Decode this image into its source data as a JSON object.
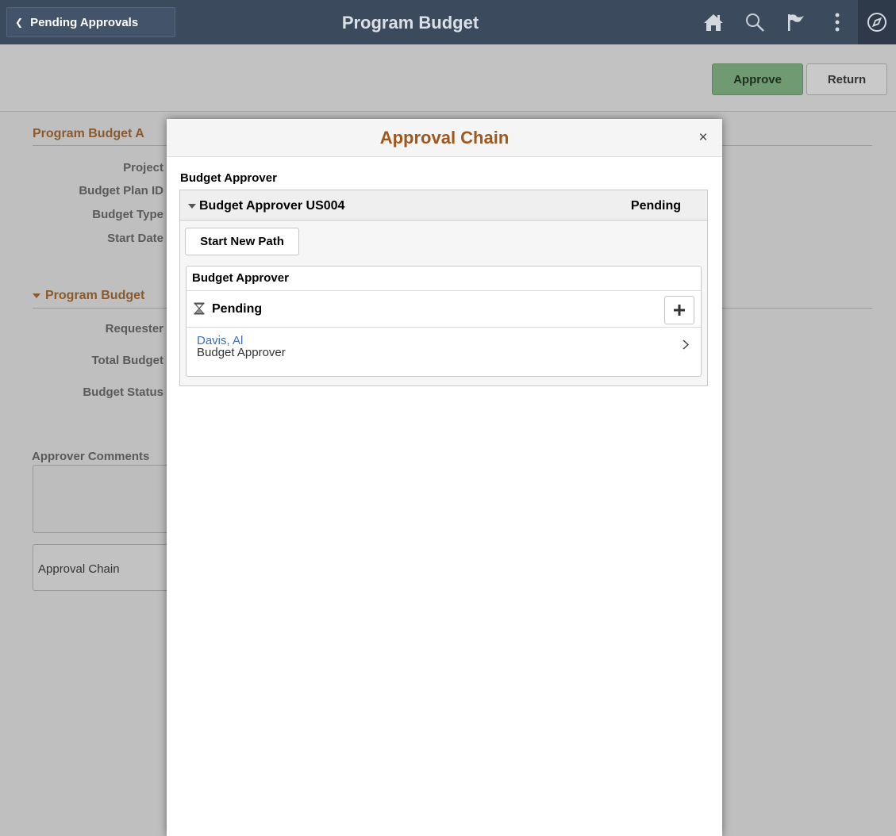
{
  "banner": {
    "back_label": "Pending Approvals",
    "title": "Program Budget",
    "icons": [
      "home-icon",
      "search-icon",
      "flag-icon",
      "actions-menu-icon",
      "navbar-icon"
    ]
  },
  "toolbar": {
    "approve_label": "Approve",
    "return_label": "Return"
  },
  "background_form": {
    "section1_title": "Program Budget A",
    "fields1": [
      "Project",
      "Budget Plan ID",
      "Budget Type",
      "Start Date"
    ],
    "section2_title": "Program Budget",
    "fields2": [
      "Requester",
      "Total Budget",
      "Budget Status"
    ],
    "comments_label": "Approver Comments",
    "approval_chain_label": "Approval Chain"
  },
  "modal": {
    "title": "Approval Chain",
    "close_symbol": "×",
    "section_label": "Budget Approver",
    "group": {
      "title": "Budget Approver US004",
      "status": "Pending",
      "start_new_path_label": "Start New Path",
      "stage": {
        "title": "Budget Approver",
        "status": "Pending",
        "approver": {
          "name": "Davis, Al",
          "role": "Budget Approver"
        }
      }
    }
  },
  "colors": {
    "banner": "#3c4a5d",
    "modal_title": "#a1561c",
    "approve_button": "#6f9a72",
    "link": "#3a6fc1"
  }
}
